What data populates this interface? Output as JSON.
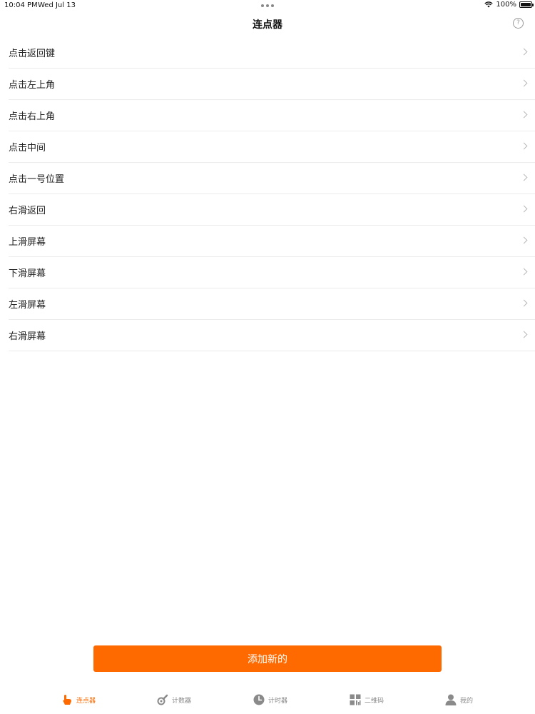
{
  "status_bar": {
    "time": "10:04 PM",
    "date": "Wed Jul 13",
    "battery": "100%"
  },
  "nav": {
    "title": "连点器",
    "help_symbol": "?"
  },
  "list": {
    "items": [
      {
        "label": "点击返回键"
      },
      {
        "label": "点击左上角"
      },
      {
        "label": "点击右上角"
      },
      {
        "label": "点击中间"
      },
      {
        "label": "点击一号位置"
      },
      {
        "label": "右滑返回"
      },
      {
        "label": "上滑屏幕"
      },
      {
        "label": "下滑屏幕"
      },
      {
        "label": "左滑屏幕"
      },
      {
        "label": "右滑屏幕"
      }
    ]
  },
  "add_button": {
    "label": "添加新的"
  },
  "tabs": [
    {
      "label": "连点器",
      "icon": "tap-hand-icon",
      "active": true
    },
    {
      "label": "计数器",
      "icon": "counter-icon",
      "active": false
    },
    {
      "label": "计时器",
      "icon": "clock-icon",
      "active": false
    },
    {
      "label": "二维码",
      "icon": "qr-code-icon",
      "active": false
    },
    {
      "label": "我的",
      "icon": "person-icon",
      "active": false
    }
  ],
  "colors": {
    "accent": "#ff6a00",
    "inactive": "#8a8a8a",
    "divider": "#ececec"
  }
}
